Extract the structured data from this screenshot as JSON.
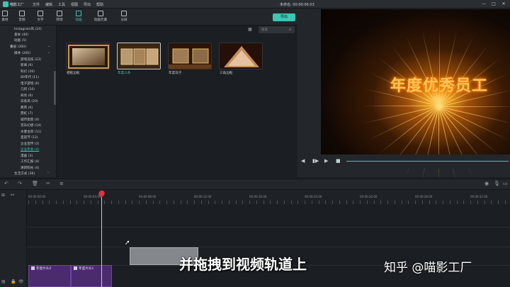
{
  "titlebar": {
    "app_name": "喵影工厂",
    "menu": [
      "文件",
      "编辑",
      "工具",
      "视图",
      "导出",
      "帮助"
    ],
    "project_info": "未命名: 00:00:06:03",
    "window_controls": [
      "—",
      "□",
      "✕"
    ]
  },
  "toolbar": {
    "tools": [
      {
        "label": "素材",
        "icon": "folder-icon"
      },
      {
        "label": "音频",
        "icon": "music-note-icon"
      },
      {
        "label": "文字",
        "icon": "text-icon"
      },
      {
        "label": "转场",
        "icon": "transition-icon"
      },
      {
        "label": "动画",
        "icon": "animation-icon"
      },
      {
        "label": "动画元素",
        "icon": "image-icon"
      },
      {
        "label": "分屏",
        "icon": "split-screen-icon"
      }
    ],
    "export_label": "导出"
  },
  "categories": [
    {
      "label": "Instagram风 (24)",
      "active": false
    },
    {
      "label": "基本 (40)",
      "active": false
    },
    {
      "label": "动画 (5)",
      "active": false
    },
    {
      "label": "叠层 (300)",
      "active": false,
      "expanded": true
    },
    {
      "label": "媒体 (200)",
      "active": false,
      "expanded": true
    },
    {
      "label": "游戏竞技 (23)",
      "active": false
    },
    {
      "label": "新闻 (6)",
      "active": false
    },
    {
      "label": "科幻 (20)",
      "active": false
    },
    {
      "label": "80年代 (11)",
      "active": false
    },
    {
      "label": "电子游戏 (6)",
      "active": false
    },
    {
      "label": "几何 (10)",
      "active": false
    },
    {
      "label": "商务 (6)",
      "active": false
    },
    {
      "label": "日系风 (20)",
      "active": false
    },
    {
      "label": "教育 (6)",
      "active": false
    },
    {
      "label": "霓虹 (7)",
      "active": false
    },
    {
      "label": "城市街景 (4)",
      "active": false
    },
    {
      "label": "音乐幻想 (14)",
      "active": false
    },
    {
      "label": "水墨古风 (11)",
      "active": false
    },
    {
      "label": "圣诞节 (12)",
      "active": false
    },
    {
      "label": "企业宣传 (3)",
      "active": false
    },
    {
      "label": "企业年会 (4)",
      "active": true
    },
    {
      "label": "漫画 (3)",
      "active": false
    },
    {
      "label": "工作汇报 (4)",
      "active": false
    },
    {
      "label": "清新阳光 (4)",
      "active": false
    },
    {
      "label": "生活方式 (36)",
      "active": false
    }
  ],
  "library": {
    "search_placeholder": "搜索",
    "items": [
      {
        "label": "相框边框",
        "selected": false
      },
      {
        "label": "年度三条",
        "selected": true
      },
      {
        "label": "年度双子",
        "selected": false
      },
      {
        "label": "三角边框",
        "selected": false
      }
    ]
  },
  "preview": {
    "title_text": "年度优秀员工",
    "controls": [
      "◀",
      "▮▶",
      "▶",
      "■"
    ]
  },
  "timeline": {
    "timecodes": [
      "00:00:00:00",
      "00:00:04:00",
      "00:00:08:00",
      "00:00:12:00",
      "00:00:16:00",
      "00:00:20:00",
      "00:00:24:00",
      "00:00:28:00",
      "00:00:32:00"
    ],
    "clips": [
      "年度片头2",
      "年度片头1"
    ]
  },
  "overlay": {
    "subtitle": "并拖拽到视频轨道上",
    "watermark": "知乎 @喵影工厂"
  },
  "colors": {
    "accent": "#3fc5b5",
    "playhead": "#e0323c",
    "clip": "#4b2a6e"
  }
}
